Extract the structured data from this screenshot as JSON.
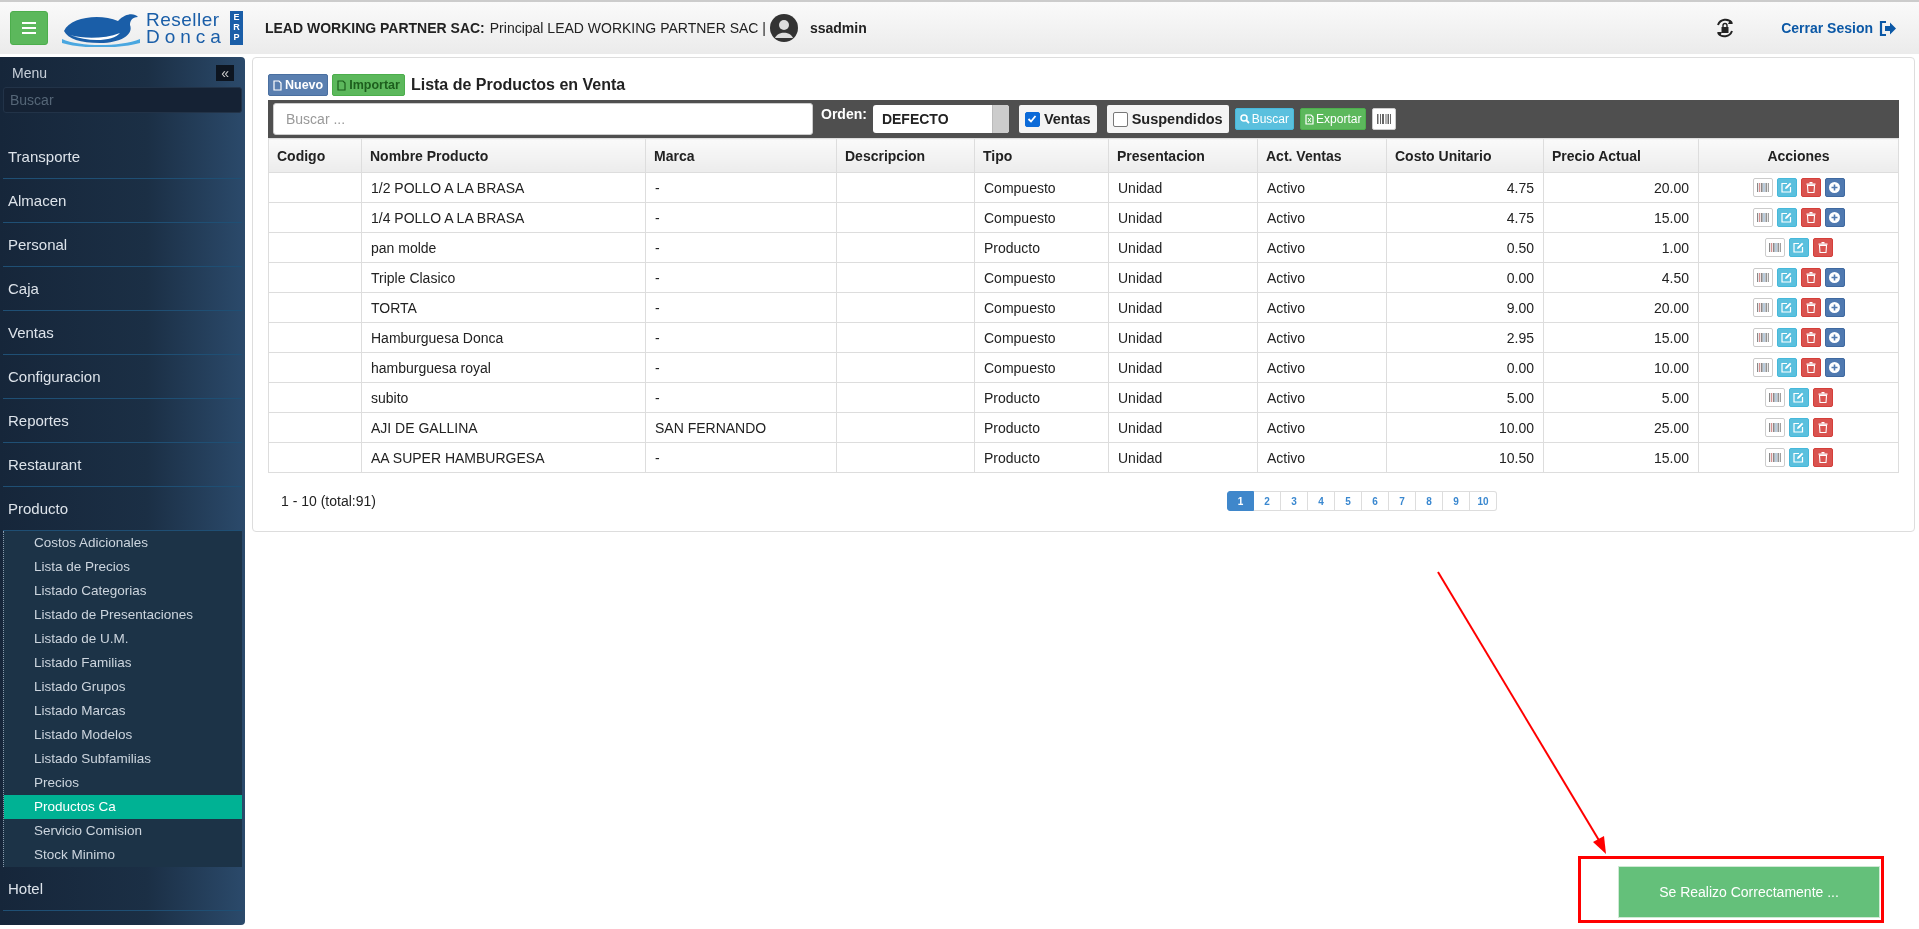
{
  "header": {
    "logo": {
      "line_1": "Reseller",
      "line_2": "Donca",
      "badge": "ERP"
    },
    "company": "LEAD WORKING PARTNER SAC:",
    "branch": "Principal LEAD WORKING PARTNER SAC |",
    "user": "ssadmin",
    "logout": "Cerrar Sesion"
  },
  "sidebar": {
    "title": "Menu",
    "collapse_icon": "«",
    "search": {
      "placeholder": "Buscar"
    },
    "items": [
      {
        "label": "Transporte"
      },
      {
        "label": "Almacen"
      },
      {
        "label": "Personal"
      },
      {
        "label": "Caja"
      },
      {
        "label": "Ventas"
      },
      {
        "label": "Configuracion"
      },
      {
        "label": "Reportes"
      },
      {
        "label": "Restaurant"
      },
      {
        "label": "Producto",
        "children": [
          {
            "label": "Costos Adicionales",
            "selected": false
          },
          {
            "label": "Lista de Precios",
            "selected": false
          },
          {
            "label": "Listado Categorias",
            "selected": false
          },
          {
            "label": "Listado de Presentaciones",
            "selected": false
          },
          {
            "label": "Listado de U.M.",
            "selected": false
          },
          {
            "label": "Listado Familias",
            "selected": false
          },
          {
            "label": "Listado Grupos",
            "selected": false
          },
          {
            "label": "Listado Marcas",
            "selected": false
          },
          {
            "label": "Listado Modelos",
            "selected": false
          },
          {
            "label": "Listado Subfamilias",
            "selected": false
          },
          {
            "label": "Precios",
            "selected": false
          },
          {
            "label": "Productos Ca",
            "selected": true
          },
          {
            "label": "Servicio Comision",
            "selected": false
          },
          {
            "label": "Stock Minimo",
            "selected": false
          }
        ]
      },
      {
        "label": "Hotel"
      }
    ]
  },
  "panel": {
    "new_button": "Nuevo",
    "import_button": "Importar",
    "title": "Lista de Productos en Venta",
    "filters": {
      "search": {
        "placeholder": "Buscar ..."
      },
      "order_label": "Orden:",
      "order_value": "DEFECTO",
      "checkboxes": [
        {
          "label": "Ventas",
          "checked": true
        },
        {
          "label": "Suspendidos",
          "checked": false
        }
      ],
      "search_button": "Buscar",
      "export_button": "Exportar"
    },
    "table": {
      "columns": [
        "Codigo",
        "Nombre Producto",
        "Marca",
        "Descripcion",
        "Tipo",
        "Presentacion",
        "Act. Ventas",
        "Costo Unitario",
        "Precio Actual",
        "Acciones"
      ],
      "rows": [
        {
          "cells": [
            "",
            "1/2 POLLO A LA BRASA",
            "-",
            "",
            "Compuesto",
            "Unidad",
            "Activo",
            "4.75",
            "20.00"
          ],
          "add_button": true
        },
        {
          "cells": [
            "",
            "1/4 POLLO A LA BRASA",
            "-",
            "",
            "Compuesto",
            "Unidad",
            "Activo",
            "4.75",
            "15.00"
          ],
          "add_button": true
        },
        {
          "cells": [
            "",
            "pan molde",
            "-",
            "",
            "Producto",
            "Unidad",
            "Activo",
            "0.50",
            "1.00"
          ],
          "add_button": false
        },
        {
          "cells": [
            "",
            "Triple Clasico",
            "-",
            "",
            "Compuesto",
            "Unidad",
            "Activo",
            "0.00",
            "4.50"
          ],
          "add_button": true
        },
        {
          "cells": [
            "",
            "TORTA",
            "-",
            "",
            "Compuesto",
            "Unidad",
            "Activo",
            "9.00",
            "20.00"
          ],
          "add_button": true
        },
        {
          "cells": [
            "",
            "Hamburguesa Donca",
            "-",
            "",
            "Compuesto",
            "Unidad",
            "Activo",
            "2.95",
            "15.00"
          ],
          "add_button": true
        },
        {
          "cells": [
            "",
            "hamburguesa royal",
            "-",
            "",
            "Compuesto",
            "Unidad",
            "Activo",
            "0.00",
            "10.00"
          ],
          "add_button": true
        },
        {
          "cells": [
            "",
            "subito",
            "-",
            "",
            "Producto",
            "Unidad",
            "Activo",
            "5.00",
            "5.00"
          ],
          "add_button": false
        },
        {
          "cells": [
            "",
            "AJI DE GALLINA",
            "SAN FERNANDO",
            "",
            "Producto",
            "Unidad",
            "Activo",
            "10.00",
            "25.00"
          ],
          "add_button": false
        },
        {
          "cells": [
            "",
            "AA SUPER HAMBURGESA",
            "-",
            "",
            "Producto",
            "Unidad",
            "Activo",
            "10.50",
            "15.00"
          ],
          "add_button": false
        }
      ]
    },
    "summary": "1 - 10 (total:91)",
    "pages": [
      {
        "label": "1",
        "selected": true
      },
      {
        "label": "2",
        "selected": false
      },
      {
        "label": "3",
        "selected": false
      },
      {
        "label": "4",
        "selected": false
      },
      {
        "label": "5",
        "selected": false
      },
      {
        "label": "6",
        "selected": false
      },
      {
        "label": "7",
        "selected": false
      },
      {
        "label": "8",
        "selected": false
      },
      {
        "label": "9",
        "selected": false
      },
      {
        "label": "10",
        "selected": false
      }
    ]
  },
  "toast": {
    "message": "Se Realizo Correctamente ..."
  }
}
